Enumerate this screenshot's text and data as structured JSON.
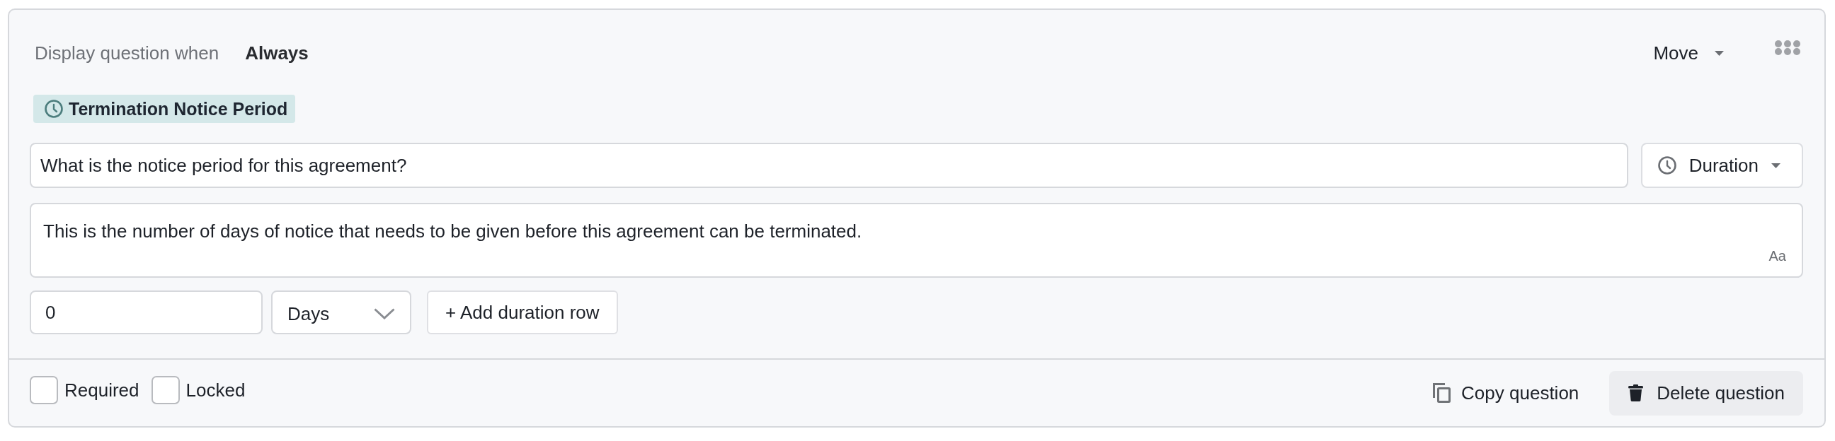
{
  "condition": {
    "label": "Display question when",
    "value": "Always"
  },
  "move_menu": {
    "label": "Move"
  },
  "tag": {
    "label": "Termination Notice Period"
  },
  "question_field": {
    "value": "What is the notice period for this agreement?"
  },
  "answer_type": {
    "label": "Duration"
  },
  "description_field": {
    "value": "This is the number of days of notice that needs to be given before this agreement can be terminated.",
    "format_button": "Aa"
  },
  "duration_rows": [
    {
      "amount": "0",
      "unit": "Days"
    }
  ],
  "add_row_button": {
    "label": "+ Add duration row"
  },
  "options": [
    {
      "label": "Required",
      "checked": false
    },
    {
      "label": "Locked",
      "checked": false
    }
  ],
  "actions": [
    {
      "kind": "copy",
      "label": "Copy question"
    },
    {
      "kind": "delete",
      "label": "Delete question"
    }
  ]
}
